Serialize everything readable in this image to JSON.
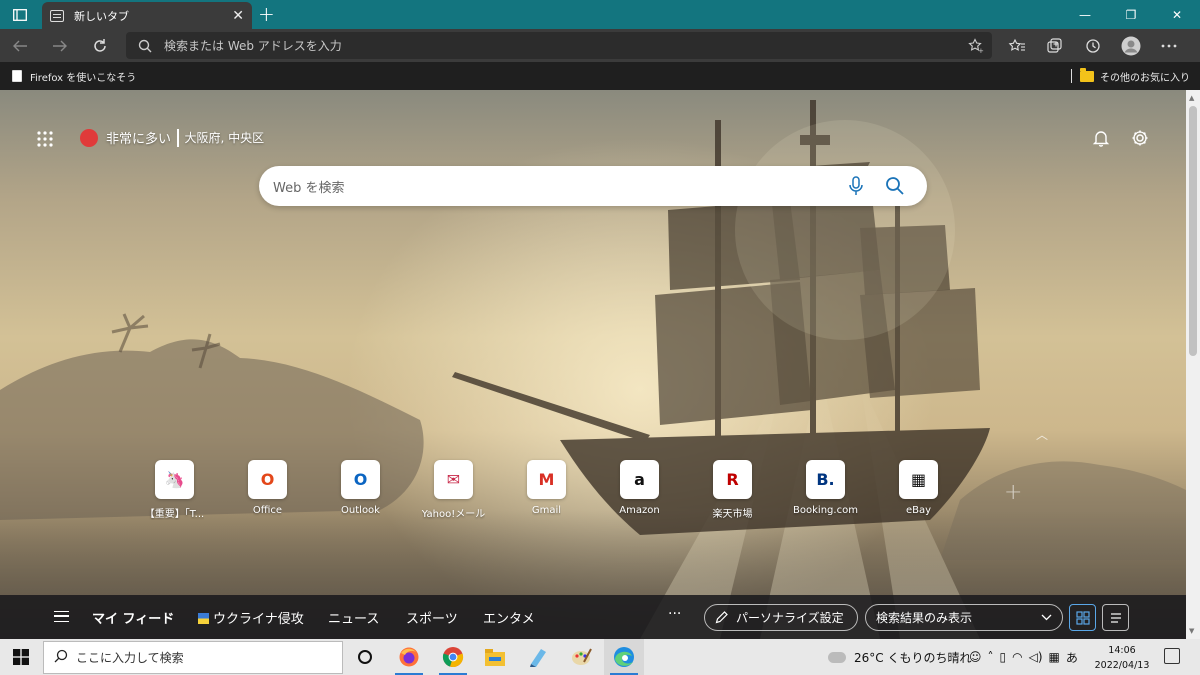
{
  "browser": {
    "tab_title": "新しいタブ",
    "tab_close": "✕",
    "new_tab": "+",
    "window_controls": [
      "—",
      "❐",
      "✕"
    ],
    "address_placeholder": "検索または Web アドレスを入力",
    "favorites": {
      "left_item": "Firefox を使いこなそう",
      "other_folder": "その他のお気に入り"
    }
  },
  "newtab": {
    "weather_status": "非常に多い",
    "location": "大阪府, 中央区",
    "search_placeholder": "Web を検索",
    "quick_links": [
      {
        "label": "【重要】「T...",
        "glyph": "🦄",
        "color": "#d93a3a"
      },
      {
        "label": "Office",
        "glyph": "O",
        "color": "#e3471a"
      },
      {
        "label": "Outlook",
        "glyph": "O",
        "color": "#0b65c2"
      },
      {
        "label": "Yahoo!メール",
        "glyph": "✉",
        "color": "#c82a4a"
      },
      {
        "label": "Gmail",
        "glyph": "M",
        "color": "#d93025"
      },
      {
        "label": "Amazon",
        "glyph": "a",
        "color": "#111111"
      },
      {
        "label": "楽天市場",
        "glyph": "R",
        "color": "#bf0000"
      },
      {
        "label": "Booking.com",
        "glyph": "B.",
        "color": "#003580"
      },
      {
        "label": "eBay",
        "glyph": "▦",
        "color": "#111111"
      }
    ],
    "feed": {
      "tabs": [
        "マイ フィード",
        "ウクライナ侵攻",
        "ニュース",
        "スポーツ",
        "エンタメ"
      ],
      "more": "···",
      "personalize": "パーソナライズ設定",
      "dropdown": "検索結果のみ表示"
    }
  },
  "taskbar": {
    "search_placeholder": "ここに入力して検索",
    "weather": "26°C くもりのち晴れ",
    "ime": "あ",
    "time": "14:06",
    "date": "2022/04/13"
  }
}
